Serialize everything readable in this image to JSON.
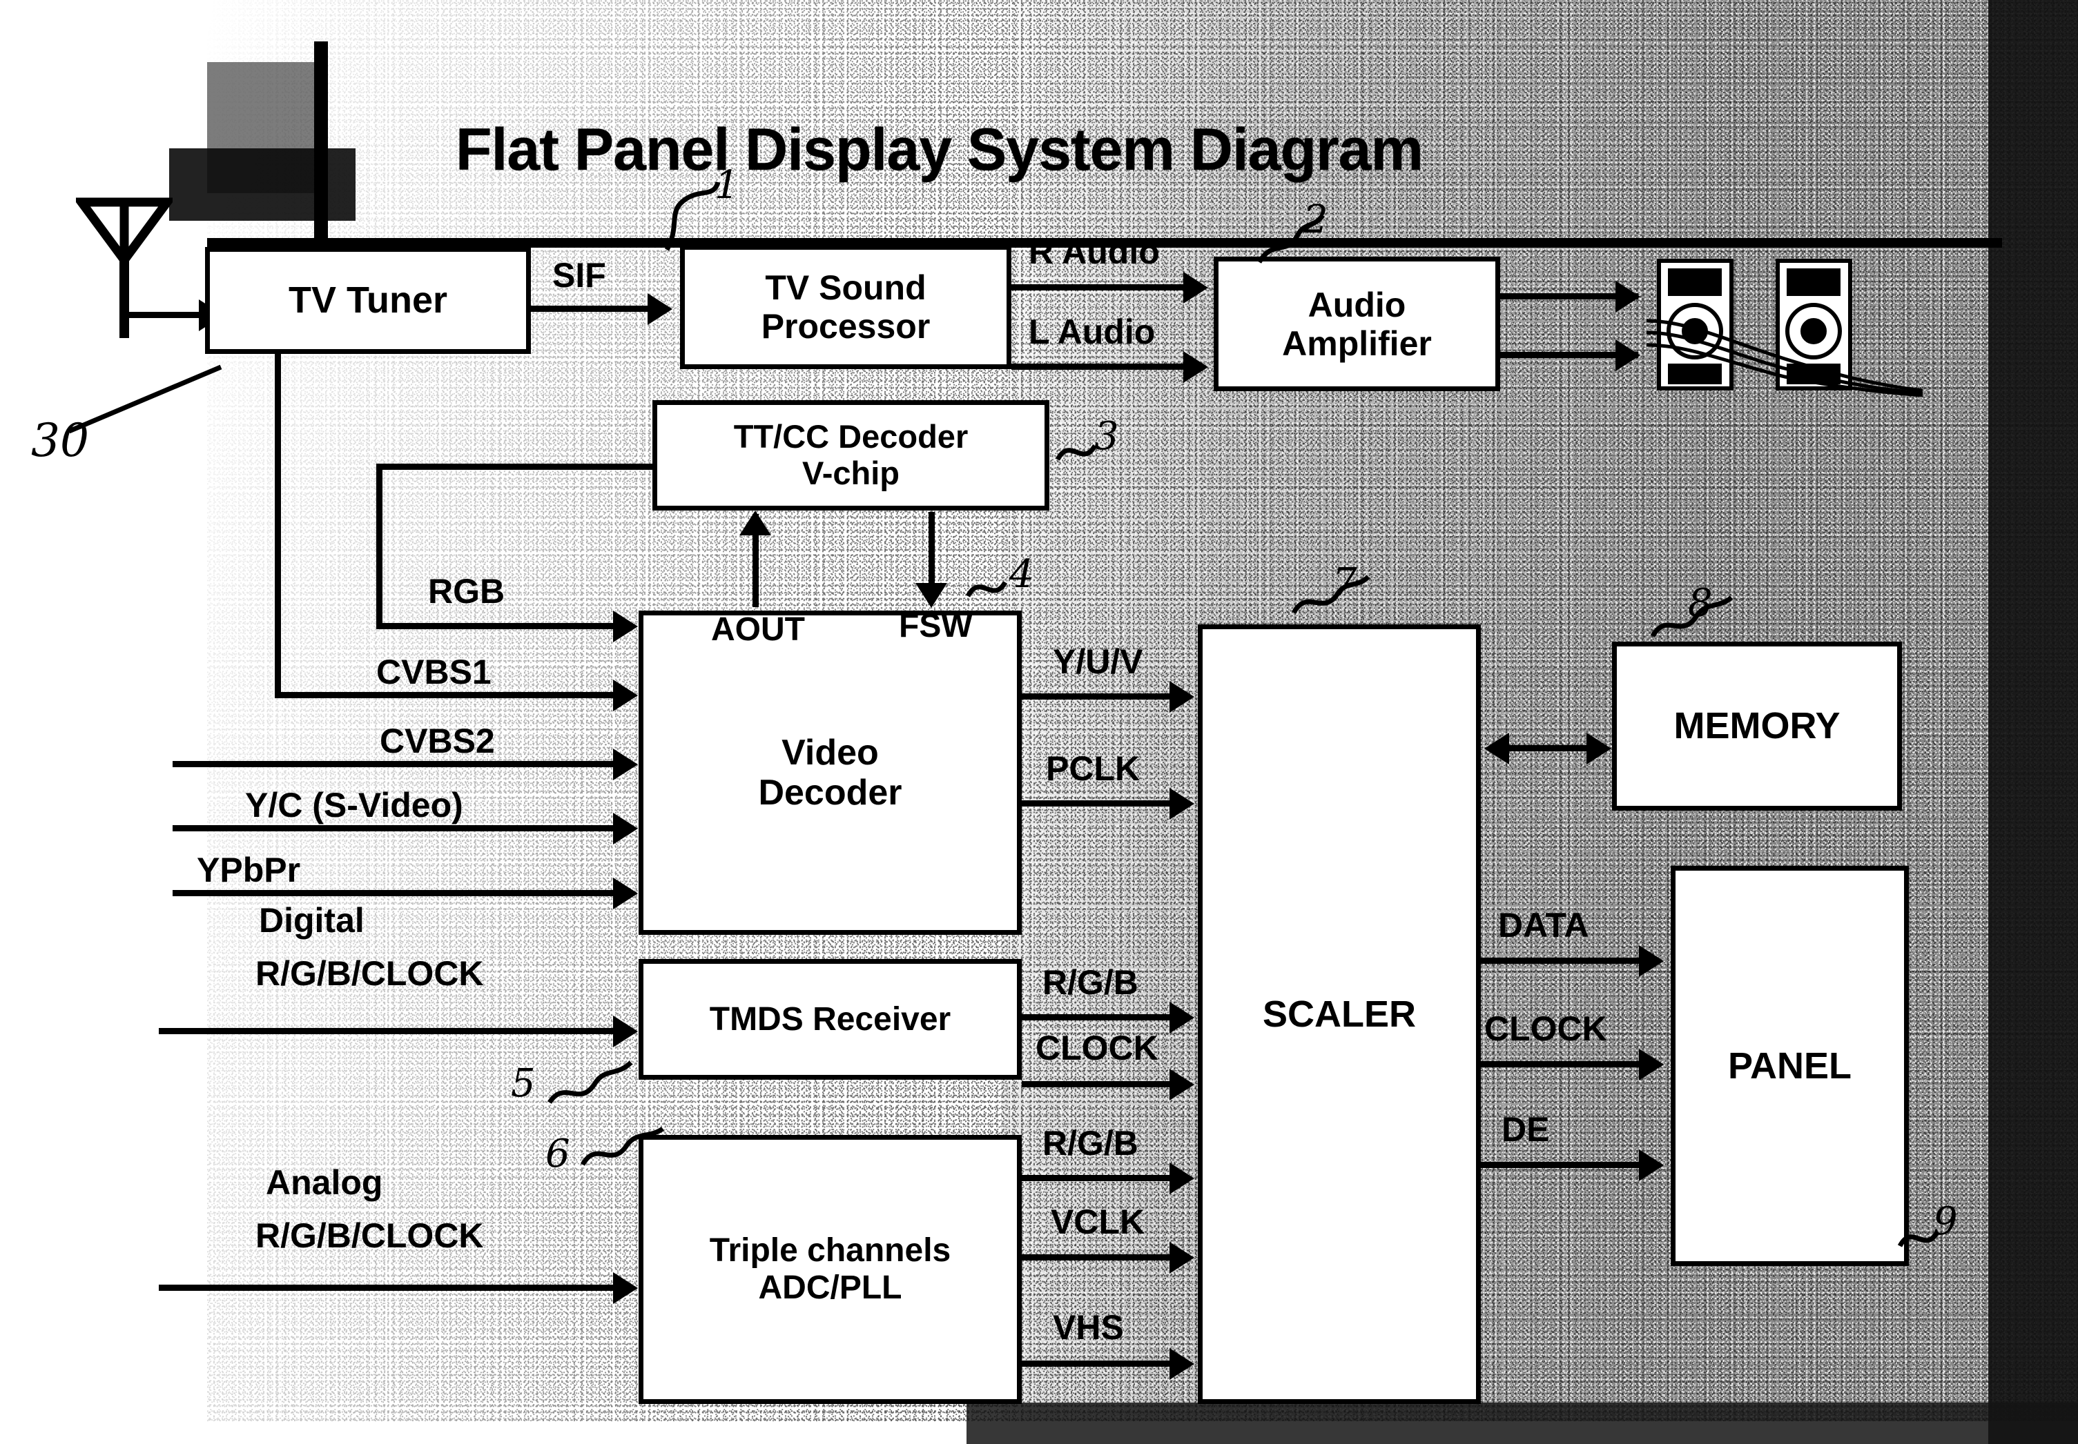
{
  "title": "Flat Panel Display System Diagram",
  "blocks": {
    "tv_tuner": "TV Tuner",
    "tv_sound_processor_l1": "TV Sound",
    "tv_sound_processor_l2": "Processor",
    "audio_amplifier_l1": "Audio",
    "audio_amplifier_l2": "Amplifier",
    "ttcc_decoder_l1": "TT/CC Decoder",
    "ttcc_decoder_l2": "V-chip",
    "video_decoder_l1": "Video",
    "video_decoder_l2": "Decoder",
    "tmds_receiver": "TMDS Receiver",
    "triple_channels_l1": "Triple channels",
    "triple_channels_l2": "ADC/PLL",
    "scaler": "SCALER",
    "memory": "MEMORY",
    "panel": "PANEL"
  },
  "signals": {
    "sif": "SIF",
    "r_audio": "R Audio",
    "l_audio": "L Audio",
    "rgb": "RGB",
    "cvbs1": "CVBS1",
    "cvbs2": "CVBS2",
    "yc_svideo": "Y/C (S-Video)",
    "ypbpr": "YPbPr",
    "digital_l1": "Digital",
    "digital_l2": "R/G/B/CLOCK",
    "analog_l1": "Analog",
    "analog_l2": "R/G/B/CLOCK",
    "aout": "AOUT",
    "fsw": "FSW",
    "yuv": "Y/U/V",
    "pclk": "PCLK",
    "rgb_tmds": "R/G/B",
    "clock_tmds": "CLOCK",
    "rgb_adc": "R/G/B",
    "vclk": "VCLK",
    "vhs": "VHS",
    "data": "DATA",
    "clock_panel": "CLOCK",
    "de": "DE"
  },
  "annotations": {
    "a30": "30",
    "a1": "1",
    "a2": "2",
    "a3": "3",
    "a4": "4",
    "a5": "5",
    "a6": "6",
    "a7": "7",
    "a8": "8",
    "a9": "9"
  },
  "icons": {
    "antenna": "antenna-icon",
    "speakers": "loudspeaker-pair-icon"
  },
  "colors": {
    "ink": "#000000",
    "paper": "#ffffff",
    "noise": "#2a2a2a"
  }
}
